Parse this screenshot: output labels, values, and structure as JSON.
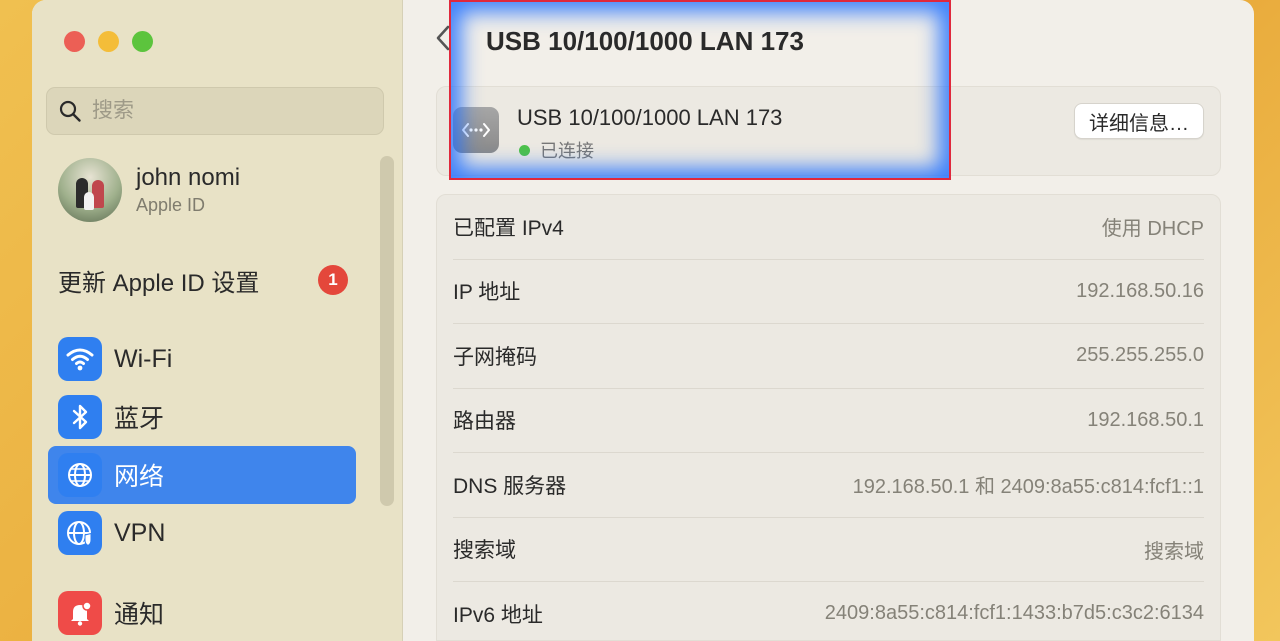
{
  "window": {
    "controls": [
      "close",
      "minimize",
      "zoom"
    ]
  },
  "sidebar": {
    "search": {
      "placeholder": "搜索"
    },
    "account": {
      "name": "john nomi",
      "subtitle": "Apple ID"
    },
    "update": {
      "label": "更新 Apple ID 设置",
      "badge": "1"
    },
    "items": [
      {
        "label": "Wi-Fi",
        "icon": "wifi-icon",
        "active": false
      },
      {
        "label": "蓝牙",
        "icon": "bluetooth-icon",
        "active": false
      },
      {
        "label": "网络",
        "icon": "globe-icon",
        "active": true
      },
      {
        "label": "VPN",
        "icon": "vpn-globe-icon",
        "active": false
      },
      {
        "label": "通知",
        "icon": "bell-icon",
        "active": false
      }
    ]
  },
  "main": {
    "title": "USB 10/100/1000 LAN 173",
    "device": {
      "name": "USB 10/100/1000 LAN 173",
      "status": "已连接",
      "details_label": "详细信息…"
    },
    "info_rows": [
      {
        "key": "已配置 IPv4",
        "value": "使用 DHCP"
      },
      {
        "key": "IP 地址",
        "value": "192.168.50.16"
      },
      {
        "key": "子网掩码",
        "value": "255.255.255.0"
      },
      {
        "key": "路由器",
        "value": "192.168.50.1"
      },
      {
        "key": "DNS 服务器",
        "value": "192.168.50.1 和 2409:8a55:c814:fcf1::1"
      },
      {
        "key": "搜索域",
        "value": "搜索域"
      },
      {
        "key": "IPv6 地址",
        "value": "2409:8a55:c814:fcf1:1433:b7d5:c3c2:6134"
      }
    ]
  },
  "colors": {
    "accent": "#3f85ec",
    "status_connected": "#4dc24a",
    "badge": "#e4473b",
    "highlight_border": "#e0283c"
  }
}
